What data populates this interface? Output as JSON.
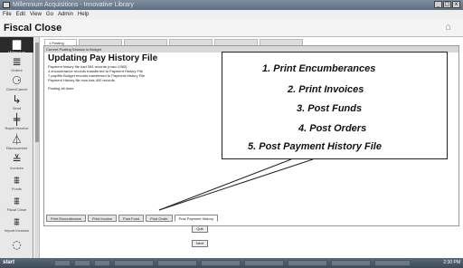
{
  "window": {
    "title": "Millennium Acquisitions - Innovative Library",
    "controls": [
      "_",
      "□",
      "x"
    ]
  },
  "menu": [
    "File",
    "Edit",
    "View",
    "Go",
    "Admin",
    "Help"
  ],
  "toolbar": {
    "title": "Fiscal Close"
  },
  "sidebar": {
    "items": [
      {
        "label": "Millennium",
        "icon": "logo-icon",
        "glyph": "▆",
        "selected": true
      },
      {
        "label": "Orders",
        "icon": "orders-icon",
        "glyph": "≣"
      },
      {
        "label": "Claim/Cancel",
        "icon": "claim-icon",
        "glyph": "⚆"
      },
      {
        "label": "Send",
        "icon": "send-icon",
        "glyph": "↳"
      },
      {
        "label": "Rapid Receive",
        "icon": "receive-icon",
        "glyph": "╪"
      },
      {
        "label": "Disencumber",
        "icon": "disencumber-icon",
        "glyph": "⏃"
      },
      {
        "label": "Invoices",
        "icon": "invoices-icon",
        "glyph": "≚"
      },
      {
        "label": "Funds",
        "icon": "funds-icon",
        "glyph": "⩩"
      },
      {
        "label": "Fiscal Close",
        "icon": "fiscal-close-icon",
        "glyph": "⩩"
      },
      {
        "label": "Import Invoices",
        "icon": "import-icon",
        "glyph": "⩩"
      },
      {
        "label": "",
        "icon": "more-icon",
        "glyph": "◌"
      }
    ]
  },
  "tabs": [
    "1.Posting",
    "",
    "",
    "",
    "",
    ""
  ],
  "panel": {
    "session": "Current Posting Session is Budget",
    "heading": "Updating Pay History File",
    "log": [
      "Payment history file had 394 records (max=1983)",
      "4 encumbrance records transferred to Payment History File",
      "7 pay/file.Budget records transferred to Payment History File",
      "Payment History file now has 400 records"
    ],
    "status": "Posting all done"
  },
  "steps": [
    "Print Encumbrance",
    "Print Invoice",
    "Post Fund",
    "Post Order",
    "Post Payment History"
  ],
  "buttons": {
    "quit": "Quit",
    "next": "Next"
  },
  "callout": {
    "items": [
      "1.   Print Encumberances",
      "2.   Print Invoices",
      "3.   Post Funds",
      "4.   Post Orders",
      "5.   Post Payment History File"
    ]
  },
  "taskbar": {
    "start": "start",
    "clock": "2:30 PM"
  }
}
